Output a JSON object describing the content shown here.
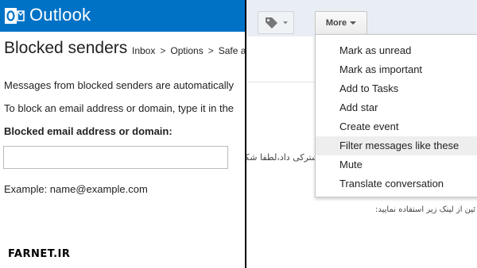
{
  "outlook": {
    "app_name": "Outlook",
    "page_title": "Blocked senders",
    "breadcrumb": [
      "Inbox",
      "Options",
      "Safe a"
    ],
    "breadcrumb_separator": ">",
    "info_line_1": "Messages from blocked senders are automatically",
    "info_line_2": "To block an email address or domain, type it in the",
    "field_label": "Blocked email address or domain:",
    "input_value": "",
    "example_text": "Example: name@example.com",
    "colors": {
      "header": "#0072c6"
    }
  },
  "watermark": "FARNET.IR",
  "gmail": {
    "label_icon": "tag-icon",
    "more_button_label": "More",
    "menu_items": [
      "Mark as unread",
      "Mark as important",
      "Add to Tasks",
      "Add star",
      "Create event",
      "Filter messages like these",
      "Mute",
      "Translate conversation"
    ],
    "highlighted_item": "Filter messages like these",
    "rtl_text_1": "ﻧﮏ ﺯﯾﺮ ﺍﺳﺘﻔﺎﺩﻩ ﻣﺸﺘﺮﮐﯽ ﺩﺍﺩ،ﻟﻄﻔﺎ ﺷﮑﯿﺒﺎ ﺑﺎﺷﯿﺪ",
    "rtl_text_2": "ﺋﯿﻦ ﺍﺯ ﻟﯿﻨﮏ ﺯﯾﺮ ﺍﺳﺘﻔﺎﺩﻩ ﻧﻤﺎﯾﯿﺪ:"
  }
}
